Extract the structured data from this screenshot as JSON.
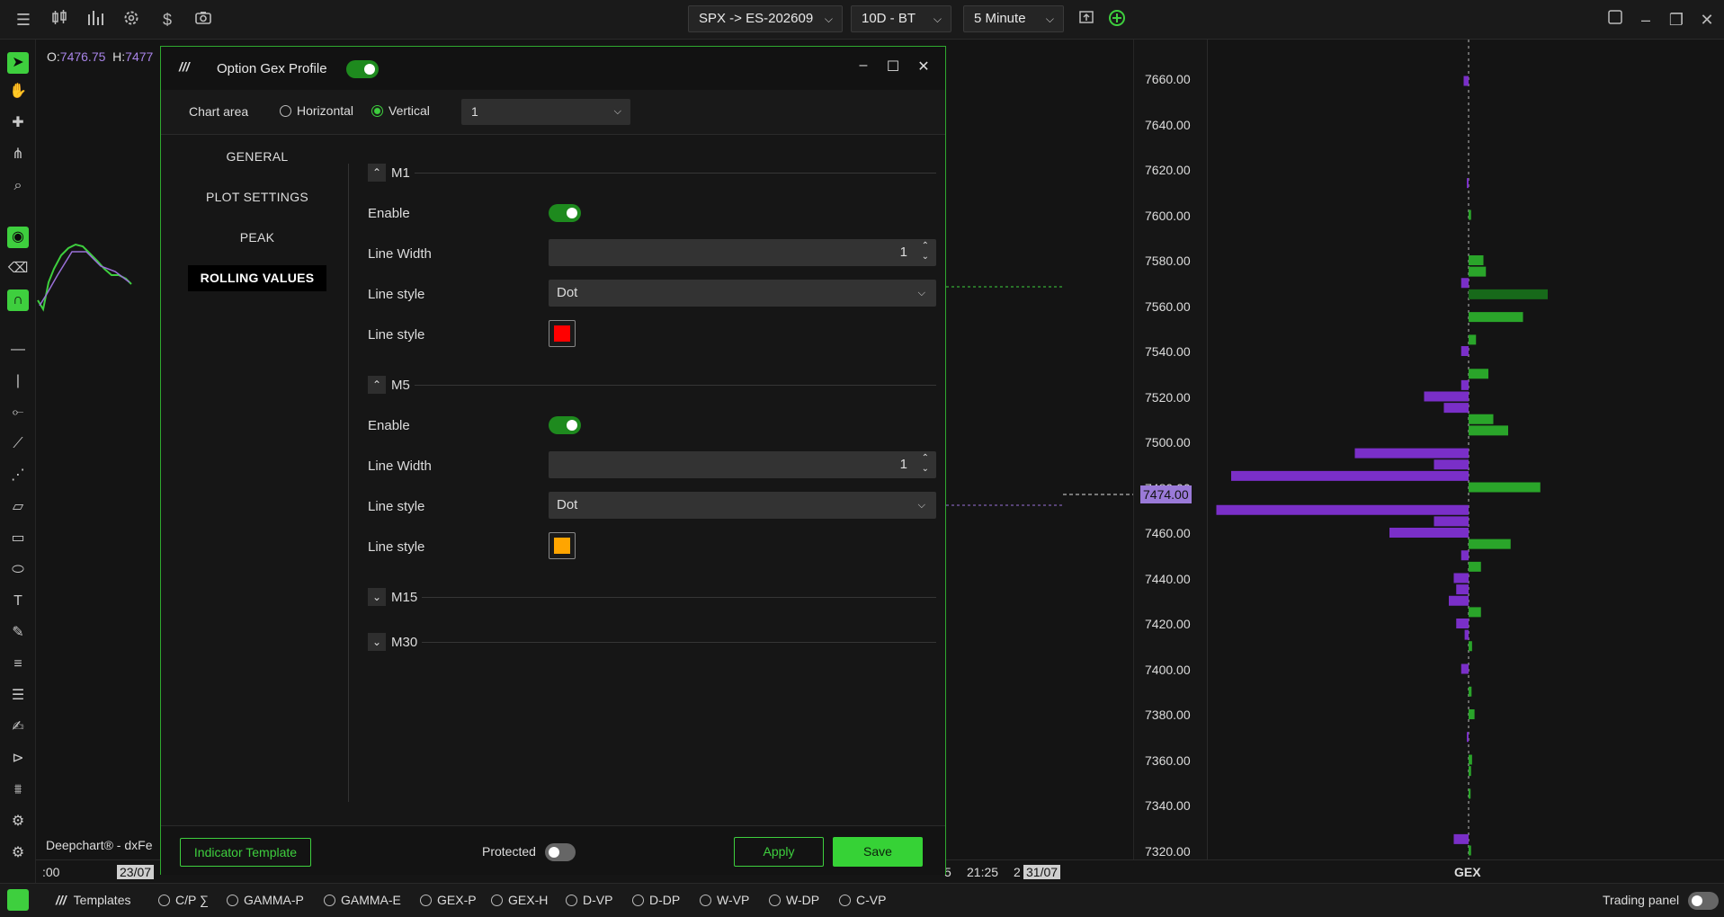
{
  "topbar": {
    "symbol": "SPX -> ES-202609",
    "period": "10D - BT",
    "timeframe": "5 Minute",
    "icons": [
      "menu-icon",
      "candles-icon",
      "bar-chart-icon",
      "settings-icon",
      "dollar-icon",
      "camera-icon"
    ]
  },
  "ohlc": {
    "o_label": "O:",
    "o_value": "7476.75",
    "h_label": "H:",
    "h_value": "7477"
  },
  "dialog": {
    "title": "Option Gex Profile",
    "enabled": true,
    "chart_area_label": "Chart area",
    "horizontal_label": "Horizontal",
    "vertical_label": "Vertical",
    "selected_orientation": "Vertical",
    "pane_value": "1",
    "sidebar": [
      {
        "label": "GENERAL"
      },
      {
        "label": "PLOT SETTINGS"
      },
      {
        "label": "PEAK"
      },
      {
        "label": "ROLLING VALUES",
        "selected": true
      }
    ],
    "m1": {
      "title": "M1",
      "enable_label": "Enable",
      "enabled": true,
      "width_label": "Line Width",
      "width": "1",
      "style_label": "Line style",
      "style": "Dot",
      "color_label": "Line style",
      "color": "#ff0000"
    },
    "m5": {
      "title": "M5",
      "enable_label": "Enable",
      "enabled": true,
      "width_label": "Line Width",
      "width": "1",
      "style_label": "Line style",
      "style": "Dot",
      "color_label": "Line style",
      "color": "#ffa500"
    },
    "m15": {
      "title": "M15"
    },
    "m30": {
      "title": "M30"
    },
    "template_label": "Indicator Template",
    "protected_label": "Protected",
    "protected": false,
    "apply_label": "Apply",
    "save_label": "Save"
  },
  "price_axis": {
    "labels": [
      "7660.00",
      "7640.00",
      "7620.00",
      "7600.00",
      "7580.00",
      "7560.00",
      "7540.00",
      "7520.00",
      "7500.00",
      "7480.00",
      "7460.00",
      "7440.00",
      "7420.00",
      "7400.00",
      "7380.00",
      "7360.00",
      "7340.00",
      "7320.00"
    ],
    "current_price": "7474.00"
  },
  "gex_label": "GEX",
  "watermark": "Deepchart® - dxFe",
  "x_axis": {
    "labels": [
      ":00",
      "23/07",
      "5",
      "21:25",
      "2",
      "31/07"
    ]
  },
  "bottombar": {
    "templates_label": "Templates",
    "items": [
      "C/P ∑",
      "GAMMA-P",
      "GAMMA-E",
      "GEX-P",
      "GEX-H",
      "D-VP",
      "D-DP",
      "W-VP",
      "W-DP",
      "C-VP"
    ],
    "trading_panel_label": "Trading panel",
    "trading_panel_on": false
  },
  "chart_data": {
    "type": "bar",
    "orientation": "horizontal",
    "xlabel": "GEX",
    "ylim": [
      7310,
      7670
    ],
    "bars": [
      {
        "price": 7659,
        "value": -1,
        "color": "#7a2fc8"
      },
      {
        "price": 7614,
        "value": -0.3,
        "color": "#7a2fc8"
      },
      {
        "price": 7600,
        "value": 0.5,
        "color": "#2aa52a"
      },
      {
        "price": 7580,
        "value": 3,
        "color": "#2aa52a"
      },
      {
        "price": 7575,
        "value": 3.5,
        "color": "#2aa52a"
      },
      {
        "price": 7570,
        "value": -1.5,
        "color": "#7a2fc8"
      },
      {
        "price": 7565,
        "value": 16,
        "color": "#17691a"
      },
      {
        "price": 7555,
        "value": 11,
        "color": "#2aa52a"
      },
      {
        "price": 7545,
        "value": 1.5,
        "color": "#2aa52a"
      },
      {
        "price": 7540,
        "value": -1.5,
        "color": "#7a2fc8"
      },
      {
        "price": 7530,
        "value": 4,
        "color": "#2aa52a"
      },
      {
        "price": 7525,
        "value": -1.5,
        "color": "#7a2fc8"
      },
      {
        "price": 7520,
        "value": -9,
        "color": "#7a2fc8"
      },
      {
        "price": 7515,
        "value": -5,
        "color": "#7a2fc8"
      },
      {
        "price": 7510,
        "value": 5,
        "color": "#2aa52a"
      },
      {
        "price": 7505,
        "value": 8,
        "color": "#2aa52a"
      },
      {
        "price": 7495,
        "value": -23,
        "color": "#7a2fc8"
      },
      {
        "price": 7490,
        "value": -7,
        "color": "#7a2fc8"
      },
      {
        "price": 7485,
        "value": -48,
        "color": "#7a2fc8"
      },
      {
        "price": 7480,
        "value": 14.5,
        "color": "#2aa52a"
      },
      {
        "price": 7470,
        "value": -51,
        "color": "#7a2fc8"
      },
      {
        "price": 7465,
        "value": -7,
        "color": "#7a2fc8"
      },
      {
        "price": 7460,
        "value": -16,
        "color": "#7a2fc8"
      },
      {
        "price": 7455,
        "value": 8.5,
        "color": "#2aa52a"
      },
      {
        "price": 7450,
        "value": -1.5,
        "color": "#7a2fc8"
      },
      {
        "price": 7445,
        "value": 2.5,
        "color": "#2aa52a"
      },
      {
        "price": 7440,
        "value": -3,
        "color": "#7a2fc8"
      },
      {
        "price": 7435,
        "value": -2.5,
        "color": "#7a2fc8"
      },
      {
        "price": 7430,
        "value": -4,
        "color": "#7a2fc8"
      },
      {
        "price": 7425,
        "value": 2.5,
        "color": "#2aa52a"
      },
      {
        "price": 7420,
        "value": -2.5,
        "color": "#7a2fc8"
      },
      {
        "price": 7415,
        "value": -0.8,
        "color": "#7a2fc8"
      },
      {
        "price": 7410,
        "value": 0.7,
        "color": "#2aa52a"
      },
      {
        "price": 7400,
        "value": -1.5,
        "color": "#7a2fc8"
      },
      {
        "price": 7390,
        "value": 0.6,
        "color": "#2aa52a"
      },
      {
        "price": 7380,
        "value": 1.2,
        "color": "#2aa52a"
      },
      {
        "price": 7370,
        "value": -0.3,
        "color": "#7a2fc8"
      },
      {
        "price": 7360,
        "value": 0.7,
        "color": "#2aa52a"
      },
      {
        "price": 7355,
        "value": 0.5,
        "color": "#2aa52a"
      },
      {
        "price": 7345,
        "value": 0.4,
        "color": "#2aa52a"
      },
      {
        "price": 7325,
        "value": -3,
        "color": "#7a2fc8"
      },
      {
        "price": 7320,
        "value": 0.5,
        "color": "#2aa52a"
      }
    ]
  },
  "colors": {
    "accent": "#3ecf3e",
    "purple": "#7a2fc8",
    "green": "#2aa52a"
  }
}
